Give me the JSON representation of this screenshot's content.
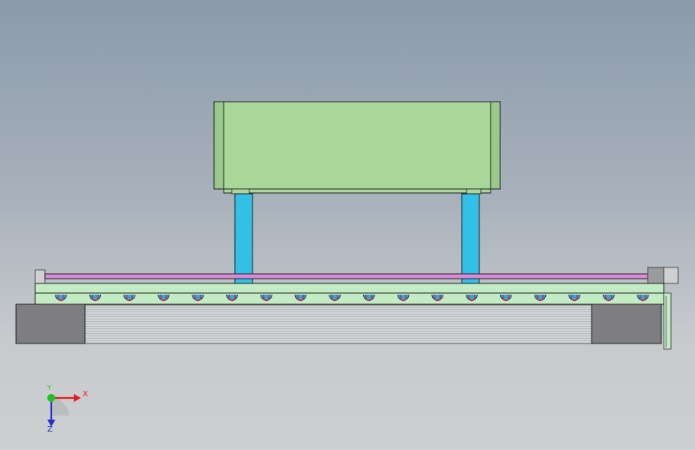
{
  "triad": {
    "x_label": "X",
    "y_label": "Y",
    "z_label": "Z",
    "x_color": "#e02020",
    "y_color": "#20c020",
    "z_color": "#2030d0"
  },
  "colors": {
    "plate_green": "#a9d79a",
    "plate_edge": "#98c98a",
    "column_blue": "#33c0e6",
    "rod_pink": "#d98ad9",
    "rail_green": "#c4ecc4",
    "block_gray": "#7e7e80",
    "roller_blue": "#2aa9e0",
    "roller_red": "#d22a3a"
  },
  "roller_count": 18
}
